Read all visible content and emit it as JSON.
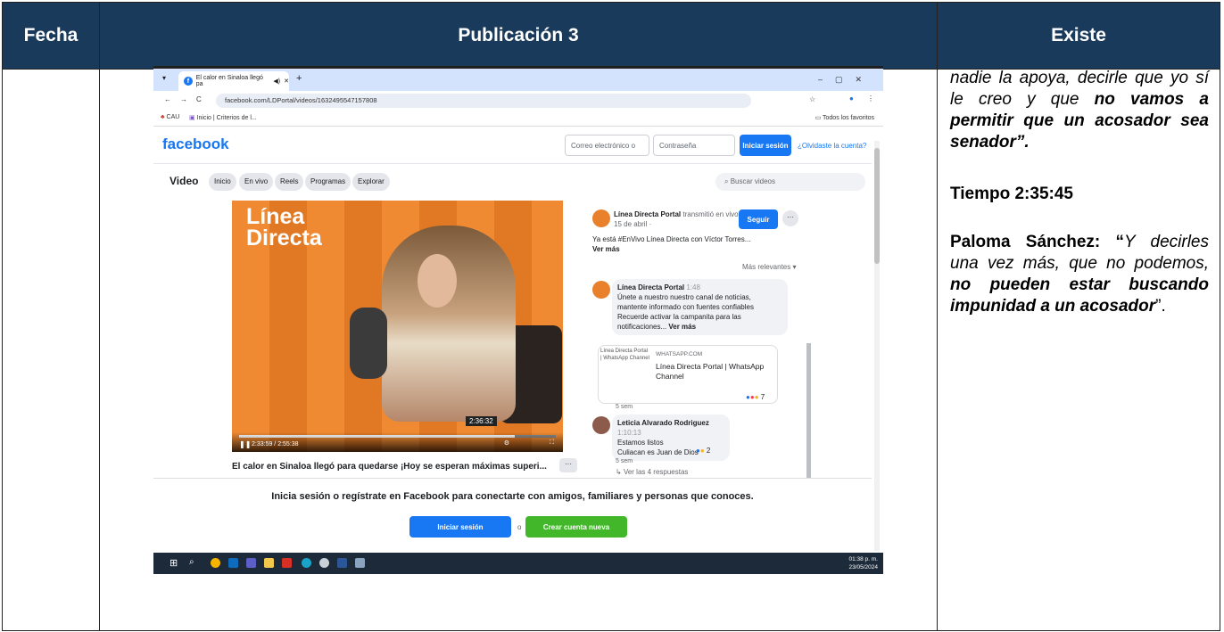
{
  "table": {
    "headers": [
      "Fecha",
      "Publicación 3",
      "Existe"
    ],
    "header_color": "#1a3a5c"
  },
  "browser": {
    "tab_title": "El calor en Sinaloa llegó pa",
    "url": "facebook.com/LDPortal/videos/1632495547157808",
    "bookmarks": [
      "CAU",
      "Inicio | Criterios de l..."
    ],
    "favorites": "Todos los favoritos"
  },
  "facebook": {
    "logo": "facebook",
    "email_placeholder": "Correo electrónico o telé",
    "password_placeholder": "Contraseña",
    "login": "Iniciar sesión",
    "forgot": "¿Olvidaste la cuenta?",
    "section": "Video",
    "nav": [
      "Inicio",
      "En vivo",
      "Reels",
      "Programas",
      "Explorar"
    ],
    "search_placeholder": "Buscar videos",
    "video_logo_1": "Línea",
    "video_logo_2": "Directa",
    "time_tip": "2:36:32",
    "time": "2:33:59 / 2:55:38",
    "video_title": "El calor en Sinaloa llegó para quedarse ¡Hoy se esperan máximas superi...",
    "channel": "Línea Directa Portal",
    "channel_suffix": "transmitió en vivo.",
    "date": "15 de abril ·",
    "follow": "Seguir",
    "post_text": "Ya está #EnVivo Línea Directa con Víctor Torres...",
    "see_more": "Ver más",
    "sort": "Más relevantes",
    "c1_author": "Línea Directa Portal",
    "c1_time": "1:48",
    "c1_text": "Únete a nuestro nuestro canal de noticias, mantente informado con fuentes confiables",
    "c1_text2": "Recuerde activar la campanita para las notificaciones...",
    "c1_more": "Ver más",
    "link_alt": "Línea Directa Portal | WhatsApp Channel",
    "link_domain": "WHATSAPP.COM",
    "link_title": "Línea Directa Portal | WhatsApp Channel",
    "c1_reactions": "7",
    "c1_age": "5 sem",
    "c2_author": "Leticia Alvarado Rodriguez",
    "c2_time": "1:10:13",
    "c2_text1": "Estamos listos",
    "c2_text2": "Culiacan es Juan de Dios",
    "c2_reactions": "2",
    "c2_age": "5 sem",
    "replies": "Ver las 4 respuestas",
    "signup_prompt": "Inicia sesión o regístrate en Facebook para conectarte con amigos, familiares y personas que conoces.",
    "signup_login": "Iniciar sesión",
    "signup_or": "o",
    "signup_create": "Crear cuenta nueva"
  },
  "taskbar": {
    "time": "01:38 p. m.",
    "date": "23/05/2024"
  },
  "right_column": {
    "p1_a": "nadie la apoya, decirle que yo sí le creo y que ",
    "p1_b": "no vamos a permitir que un acosador sea senador",
    "p1_c": "”.",
    "p2": "Tiempo 2:35:45",
    "p3_name": "Paloma Sánchez: “",
    "p3_a": "Y decirles una vez más, que no podemos, ",
    "p3_b": "no pueden estar buscando impunidad a un acosador",
    "p3_c": "”."
  },
  "progress": {
    "played_fraction": 0.87
  }
}
